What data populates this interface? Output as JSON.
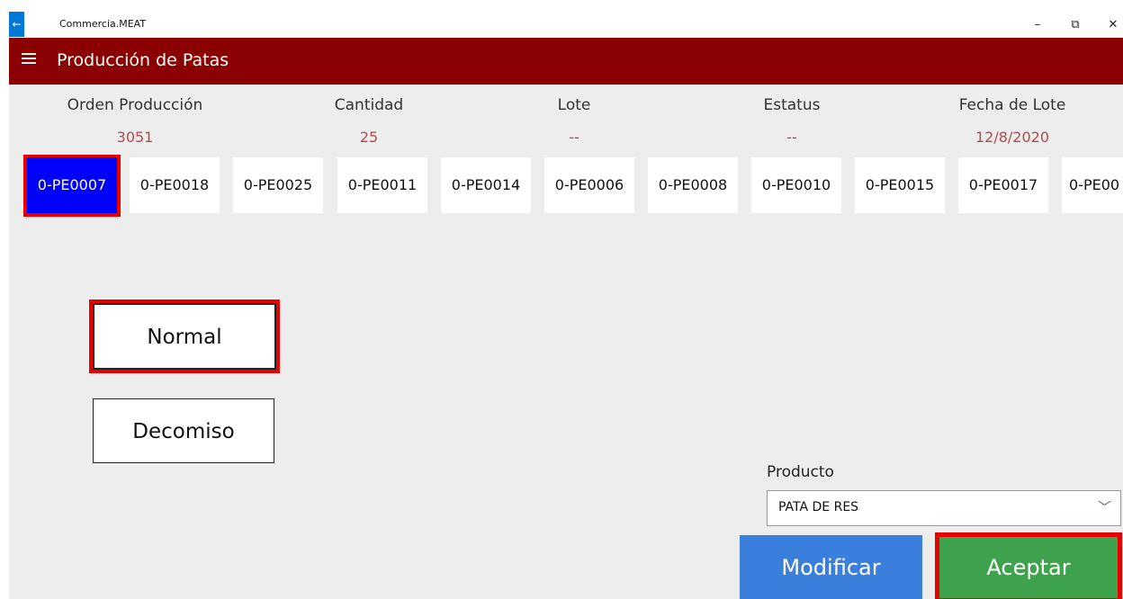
{
  "window": {
    "app_title": "Commercia.MEAT",
    "back_glyph": "←",
    "minimize_glyph": "–",
    "restore_glyph": "⧉",
    "close_glyph": "✕"
  },
  "header": {
    "title": "Producción de Patas"
  },
  "info": {
    "orden_label": "Orden Producción",
    "orden_value": "3051",
    "cantidad_label": "Cantidad",
    "cantidad_value": "25",
    "lote_label": "Lote",
    "lote_value": "--",
    "estatus_label": "Estatus",
    "estatus_value": "--",
    "fecha_label": "Fecha de Lote",
    "fecha_value": "12/8/2020"
  },
  "tags": [
    "0-PE0007",
    "0-PE0018",
    "0-PE0025",
    "0-PE0011",
    "0-PE0014",
    "0-PE0006",
    "0-PE0008",
    "0-PE0010",
    "0-PE0015",
    "0-PE0017",
    "0-PE00"
  ],
  "selected_tag": "0-PE0007",
  "tipo": {
    "normal_label": "Normal",
    "decomiso_label": "Decomiso"
  },
  "producto": {
    "label": "Producto",
    "selected": "PATA DE RES"
  },
  "actions": {
    "modificar_label": "Modificar",
    "aceptar_label": "Aceptar"
  },
  "colors": {
    "header_bg": "#8b0000",
    "value_text": "#b5484a",
    "selected_tag_bg": "#0000ff",
    "highlight_frame": "#e60000",
    "modificar_bg": "#3b7fdc",
    "aceptar_bg": "#3fa34d"
  }
}
